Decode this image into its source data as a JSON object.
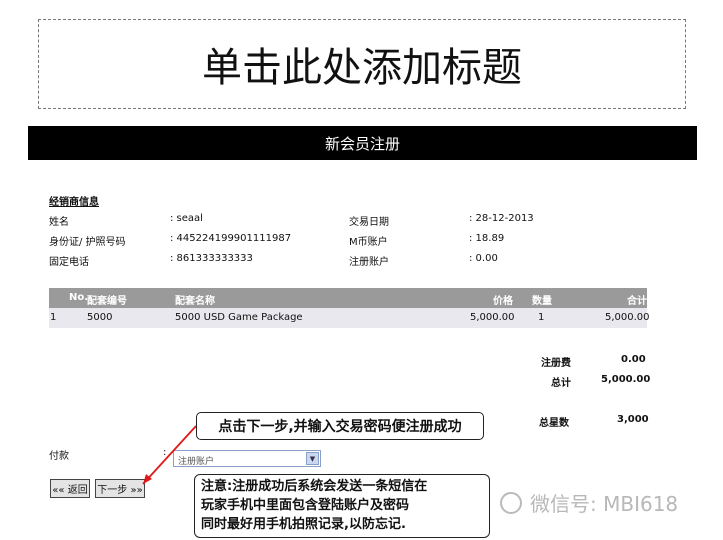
{
  "slide_title": "单击此处添加标题",
  "banner_title": "新会员注册",
  "dealer_section": "经销商信息",
  "info_left": [
    {
      "label": "姓名",
      "value": ": seaal"
    },
    {
      "label": "身份证/ 护照号码",
      "value": ": 445224199901111987"
    },
    {
      "label": "固定电话",
      "value": ": 861333333333"
    }
  ],
  "info_right": [
    {
      "label": "交易日期",
      "value": ": 28-12-2013"
    },
    {
      "label": "M币账户",
      "value": ": 18.89"
    },
    {
      "label": "注册账户",
      "value": ": 0.00"
    }
  ],
  "table": {
    "headers": {
      "no": "No.",
      "code": "配套编号",
      "name": "配套名称",
      "price": "价格",
      "qty": "数量",
      "total": "合计"
    },
    "row": {
      "no": "1",
      "code": "5000",
      "name": "5000 USD Game Package",
      "price": "5,000.00",
      "qty": "1",
      "total": "5,000.00"
    }
  },
  "summary": {
    "fee_label": "注册费",
    "fee_value": "0.00",
    "total_label": "总计",
    "total_value": "5,000.00",
    "stars_label": "总星数",
    "stars_value": "3,000"
  },
  "payment": {
    "label": "付款",
    "colon": ":",
    "selected": "注册账户"
  },
  "buttons": {
    "back": "«« 返回",
    "next": "下一步 »»"
  },
  "callout_next": "点击下一步,并输入交易密码便注册成功",
  "callout_note": [
    "注意:注册成功后系统会发送一条短信在",
    "玩家手机中里面包含登陆账户及密码",
    "同时最好用手机拍照记录,以防忘记."
  ],
  "watermark": "微信号: MBI618"
}
